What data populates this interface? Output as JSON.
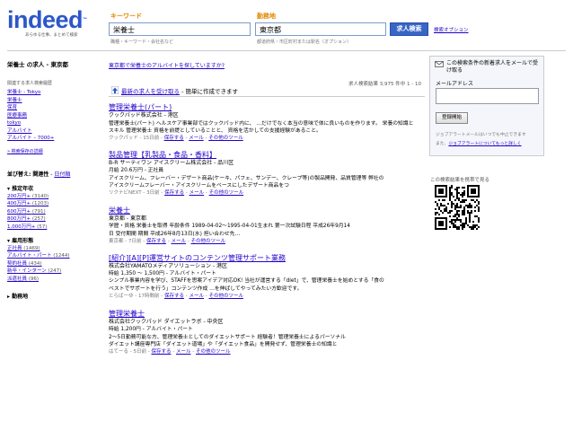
{
  "logo": {
    "word": "indeed",
    "tm": "™",
    "tagline": "あらゆる仕事、まとめて検索"
  },
  "search": {
    "what_label": "キーワード",
    "where_label": "勤務地",
    "what_value": "栄養士",
    "where_value": "東京都",
    "what_hint": "職種・キーワード・会社名など",
    "where_hint": "都道府県・市区町村または駅名（オプション）",
    "button": "求人検索",
    "options": "検索オプション"
  },
  "sidebar": {
    "title": "栄養士 の求人 - 東京都",
    "related_head": "関連する求人検索履歴",
    "related": [
      "栄養士 - Tokyo",
      "栄養士",
      "保育",
      "医療事務",
      "tokyo",
      "アルバイト",
      "アルバイト – 7000+"
    ],
    "save_link": "» 検索保存の詳細",
    "sort_label": "並び替え:",
    "sort_relevance": "関連性",
    "sort_date": "日付順",
    "salary_head": "▾ 推定年収",
    "salary": [
      {
        "label": "200万円+",
        "count": "(3140)"
      },
      {
        "label": "400万円+",
        "count": "(1203)"
      },
      {
        "label": "600万円+",
        "count": "(791)"
      },
      {
        "label": "800万円+",
        "count": "(257)"
      },
      {
        "label": "1,000万円+",
        "count": "(57)"
      }
    ],
    "type_head": "▾ 雇用形態",
    "types": [
      {
        "label": "正社員",
        "count": "(1469)"
      },
      {
        "label": "アルバイト・パート",
        "count": "(1244)"
      },
      {
        "label": "契約社員",
        "count": "(434)"
      },
      {
        "label": "新卒・インターン",
        "count": "(247)"
      },
      {
        "label": "派遣社員",
        "count": "(96)"
      }
    ],
    "location_head": "▸ 勤務地"
  },
  "main": {
    "promo": "東京都で栄養士のアルバイトを探していますか?",
    "alert_link": "最新の求人を受け取る",
    "alert_text": "- 簡単に作成できます",
    "result_count": "求人検索結果 3,975 件中 1 - 10",
    "jobs": [
      {
        "title": "管理栄養士(パート)",
        "company": "クックパッド株式会社 - 港区",
        "lines": [
          "管理栄養士(パート) ヘルスケア事業部ではクックパッド内に、 …だけでなく本当の意味で体に良いものを作ります。 栄養の知識と",
          "スキル 管理栄養士 資格を前提としていることと、 資格を活かしての支援経験があること。"
        ],
        "meta_prefix": "クックパッド - 15日前 - ",
        "meta_links": [
          "保存する",
          "メール",
          "その他のツール"
        ]
      },
      {
        "title": "製品管理【乳製品・食品・香料】",
        "company": "B-R サーティワン アイスクリーム株式会社 - 品川区",
        "lines": [
          "月給 20.6万円 - 正社員",
          "アイスクリーム、フレーバー・デザート商品(ケーキ、パフェ、サンデー、クレープ等)の製品開発、品質管理等 弊社の",
          "アイスクリームフレーバー・アイスクリームをベースにしたデザート商品をつ"
        ],
        "meta_prefix": "リクナビNEXT - 3日前 - ",
        "meta_links": [
          "保存する",
          "メール",
          "その他のツール"
        ]
      },
      {
        "title": "栄養士",
        "company": "東京都 - 東京都",
        "lines": [
          "学歴・資格 栄養士を取得 年齢条件 1989-04-02～1995-04-01生まれ 第一次試験日程 平成26年9月14",
          "日 受付期間 期間 平成26年8月13日(水) 担い合わせ先…"
        ],
        "meta_prefix": "東京都 - 7日前 - ",
        "meta_links": [
          "保存する",
          "メール",
          "その他のツール"
        ]
      },
      {
        "title": "[紹介][A][P]運営サイトのコンテンツ管理サポート業務",
        "company": "株式会社YAMATOメディアソリューション - 港区",
        "lines": [
          "時給 1,350 ～ 1,500円 - アルバイト・パート",
          "シンプル事業内容を学び、STAFFを思案アイデア対応OK! 当社が運営する「diet」で、管理栄養士を始めとする「食の",
          "ベストでサポートを行う」コンテンツ作成 …を伸ばしてやってみたい方歓迎です。"
        ],
        "meta_prefix": "とらばーゆ - 17時間前 - ",
        "meta_links": [
          "保存する",
          "メール",
          "その他のツール"
        ]
      },
      {
        "title": "管理栄養士",
        "company": "株式会社クックパッド ダイエットラボ - 中央区",
        "lines": [
          "時給 1,200円 - アルバイト・パート",
          "2～5日勤務可能な方、管理栄養士としてのダイエットサポート 経験者！管理栄養士によるパーソナル",
          "ダイエット講座専門店「ダイエット道場」や「ダイエット食品」を開発せず、管理栄養士の知識と"
        ],
        "meta_prefix": "はてーる - 5日前 - ",
        "meta_links": [
          "保存する",
          "メール",
          "その他のツール"
        ]
      }
    ]
  },
  "right": {
    "alert_title": "この検索条件の新着求人をメールで受け取る",
    "email_label": "メールアドレス",
    "register_button": "登録開始",
    "note1": "ジョブアラートメールはいつでも中止できます",
    "note2_prefix": "また、",
    "note2_link": "ジョブアラートについてもっと詳しく",
    "qr_caption": "この検索結果を携帯で見る"
  }
}
